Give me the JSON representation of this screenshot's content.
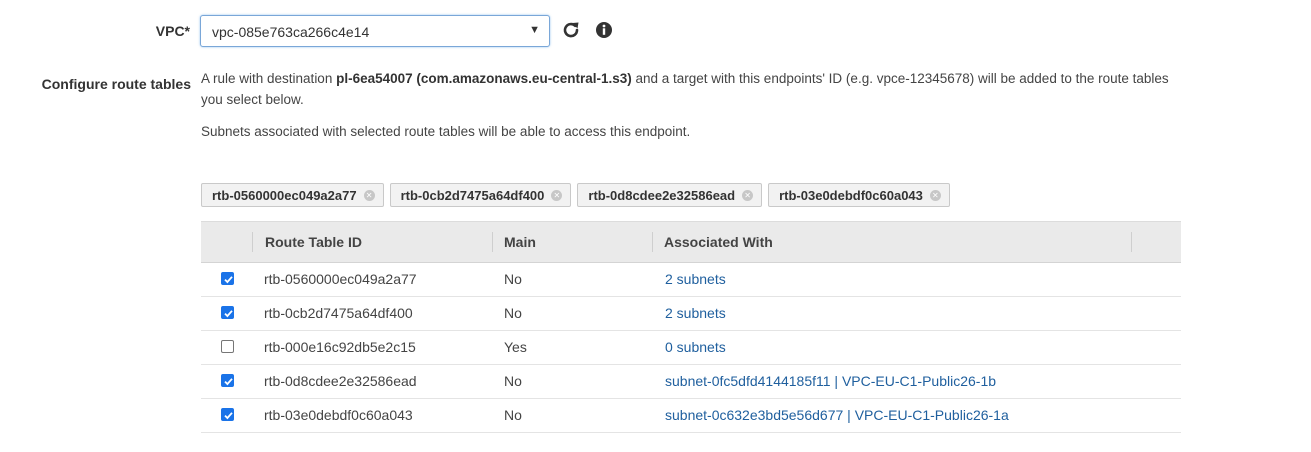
{
  "vpc": {
    "label": "VPC*",
    "selected_value": "vpc-085e763ca266c4e14",
    "caret": "▼"
  },
  "route_tables": {
    "label": "Configure route tables",
    "desc_prefix": "A rule with destination ",
    "desc_bold": "pl-6ea54007 (com.amazonaws.eu-central-1.s3)",
    "desc_suffix": " and a target with this endpoints' ID (e.g. vpce-12345678) will be added to the route tables you select below.",
    "subnet_note": "Subnets associated with selected route tables will be able to access this endpoint.",
    "selected_tokens": [
      "rtb-0560000ec049a2a77",
      "rtb-0cb2d7475a64df400",
      "rtb-0d8cdee2e32586ead",
      "rtb-03e0debdf0c60a043"
    ],
    "token_remove_glyph": "✕",
    "columns": [
      "Route Table ID",
      "Main",
      "Associated With"
    ],
    "rows": [
      {
        "checked": true,
        "id": "rtb-0560000ec049a2a77",
        "main": "No",
        "associated": "2 subnets"
      },
      {
        "checked": true,
        "id": "rtb-0cb2d7475a64df400",
        "main": "No",
        "associated": "2 subnets"
      },
      {
        "checked": false,
        "id": "rtb-000e16c92db5e2c15",
        "main": "Yes",
        "associated": "0 subnets"
      },
      {
        "checked": true,
        "id": "rtb-0d8cdee2e32586ead",
        "main": "No",
        "associated": "subnet-0fc5dfd4144185f11 | VPC-EU-C1-Public26-1b"
      },
      {
        "checked": true,
        "id": "rtb-03e0debdf0c60a043",
        "main": "No",
        "associated": "subnet-0c632e3bd5e56d677 | VPC-EU-C1-Public26-1a"
      }
    ]
  },
  "icons": {
    "refresh": "refresh-icon",
    "info": "info-icon",
    "check": "checkmark-icon"
  },
  "colors": {
    "link": "#1f5f9e",
    "checkbox_checked": "#1a73e8",
    "header_bg": "#eaeaea",
    "focus_border": "#7aa7d8"
  }
}
